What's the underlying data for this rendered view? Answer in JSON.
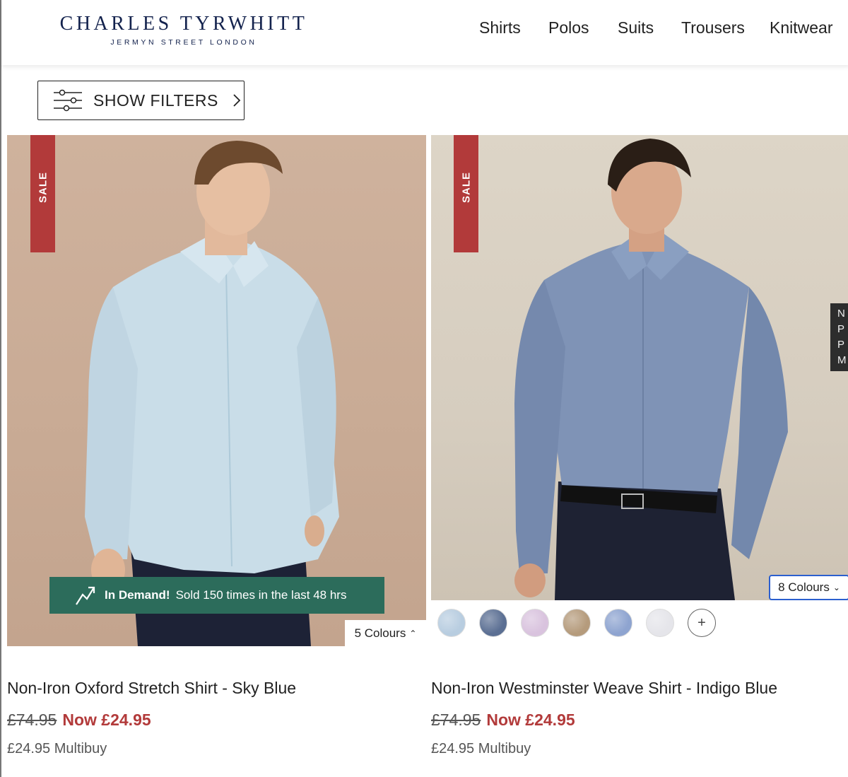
{
  "header": {
    "logo_main": "CHARLES TYRWHITT",
    "logo_sub": "JERMYN STREET LONDON",
    "nav": [
      "Shirts",
      "Polos",
      "Suits",
      "Trousers",
      "Knitwear"
    ]
  },
  "filters": {
    "label": "SHOW FILTERS",
    "icon": "sliders-icon"
  },
  "products": [
    {
      "sale_label": "SALE",
      "demand_title": "In Demand!",
      "demand_text": "Sold 150 times in the last 48 hrs",
      "colours_label": "5 Colours",
      "name": "Non-Iron Oxford Stretch Shirt - Sky Blue",
      "was_price": "£74.95",
      "now_price": "Now £24.95",
      "multibuy": "£24.95 Multibuy"
    },
    {
      "sale_label": "SALE",
      "colours_label": "8 Colours",
      "swatch_colors": [
        "#b8cde0",
        "#5b6f93",
        "#d9c3de",
        "#b59b7c",
        "#8ea4d0",
        "#e5e5ea"
      ],
      "swatch_more": "+",
      "name": "Non-Iron Westminster Weave Shirt - Indigo Blue",
      "was_price": "£74.95",
      "now_price": "Now £24.95",
      "multibuy": "£24.95 Multibuy"
    }
  ],
  "side_tab": {
    "lines": [
      "N",
      "P",
      "P",
      "M"
    ]
  },
  "colors": {
    "brand_navy": "#13224d",
    "sale_red": "#b23a3a",
    "demand_green": "#2c6c5b",
    "focus_blue": "#2b5fcf"
  }
}
